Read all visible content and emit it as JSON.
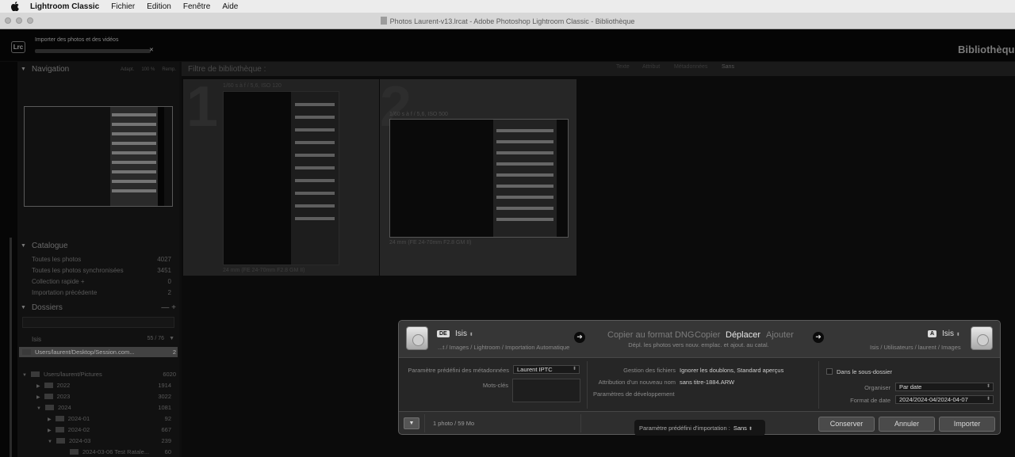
{
  "menubar": {
    "app": "Lightroom Classic",
    "items": [
      "Fichier",
      "Edition",
      "Fenêtre",
      "Aide"
    ]
  },
  "window": {
    "title": "Photos Laurent-v13.lrcat - Adobe Photoshop Lightroom Classic - Bibliothèque"
  },
  "header": {
    "logo": "Lrc",
    "import_task": "Importer des photos et des vidéos",
    "close": "✕",
    "module": "Bibliothèque"
  },
  "left_panel": {
    "navigator": {
      "title": "Navigation",
      "options": [
        "Adapt.",
        "100 %",
        "Remp."
      ]
    },
    "catalog": {
      "title": "Catalogue",
      "rows": [
        {
          "label": "Toutes les photos",
          "count": "4027"
        },
        {
          "label": "Toutes les photos synchronisées",
          "count": "3451"
        },
        {
          "label": "Collection rapide +",
          "count": "0"
        },
        {
          "label": "Importation précédente",
          "count": "2"
        }
      ]
    },
    "folders": {
      "title": "Dossiers",
      "volume": "Isis",
      "volume_info": "55 / 76",
      "rows": [
        {
          "label": "Users/laurent/Desktop/Session.com...",
          "count": "2"
        },
        {
          "label": "Users/laurent/Pictures",
          "count": "6020"
        },
        {
          "label": "2022",
          "count": "1914"
        },
        {
          "label": "2023",
          "count": "3022"
        },
        {
          "label": "2024",
          "count": "1081"
        },
        {
          "label": "2024-01",
          "count": "92"
        },
        {
          "label": "2024-02",
          "count": "667"
        },
        {
          "label": "2024-03",
          "count": "239"
        },
        {
          "label": "2024-03-06 Test Ratale...",
          "count": "60"
        }
      ]
    }
  },
  "filter_bar": {
    "title": "Filtre de bibliothèque :",
    "options": [
      "Texte",
      "Attribut",
      "Métadonnées",
      "Sans"
    ]
  },
  "grid": {
    "cells": [
      {
        "index": "1",
        "exposure": "1/60 s à f / 5,6, ISO 120",
        "lens": "24 mm (FE 24-70mm F2.8 GM II)"
      },
      {
        "index": "2",
        "exposure": "1/60 s à f / 5,6, ISO 500",
        "lens": "24 mm (FE 24-70mm F2.8 GM II)"
      }
    ]
  },
  "import_dialog": {
    "source": {
      "badge": "DE",
      "name": "Isis",
      "path": "...t / Images / Lightroom / Importation Automatique"
    },
    "modes": [
      "Copier au format DNG",
      "Copier",
      "Déplacer",
      "Ajouter"
    ],
    "active_mode": "Déplacer",
    "mode_description": "Dépl. les photos vers nouv. emplac. et ajout. au catal.",
    "destination": {
      "badge": "A",
      "name": "Isis",
      "path": "Isis / Utilisateurs / laurent / Images"
    },
    "metadata_preset_label": "Paramètre prédéfini des métadonnées",
    "metadata_preset_value": "Laurent IPTC",
    "keywords_label": "Mots-clés",
    "file_handling_label": "Gestion des fichiers",
    "file_handling_value": "Ignorer les doublons, Standard aperçus",
    "rename_label": "Attribution d'un nouveau nom",
    "rename_value": "sans titre-1884.ARW",
    "develop_label": "Paramètres de développement",
    "subfolder_label": "Dans le sous-dossier",
    "organize_label": "Organiser",
    "organize_value": "Par date",
    "date_format_label": "Format de date",
    "date_format_value": "2024/2024-04/2024-04-07",
    "photo_count": "1 photo / 59 Mo",
    "import_preset_label": "Paramètre prédéfini d'importation :",
    "import_preset_value": "Sans",
    "buttons": {
      "keep": "Conserver",
      "cancel": "Annuler",
      "import": "Importer"
    }
  }
}
